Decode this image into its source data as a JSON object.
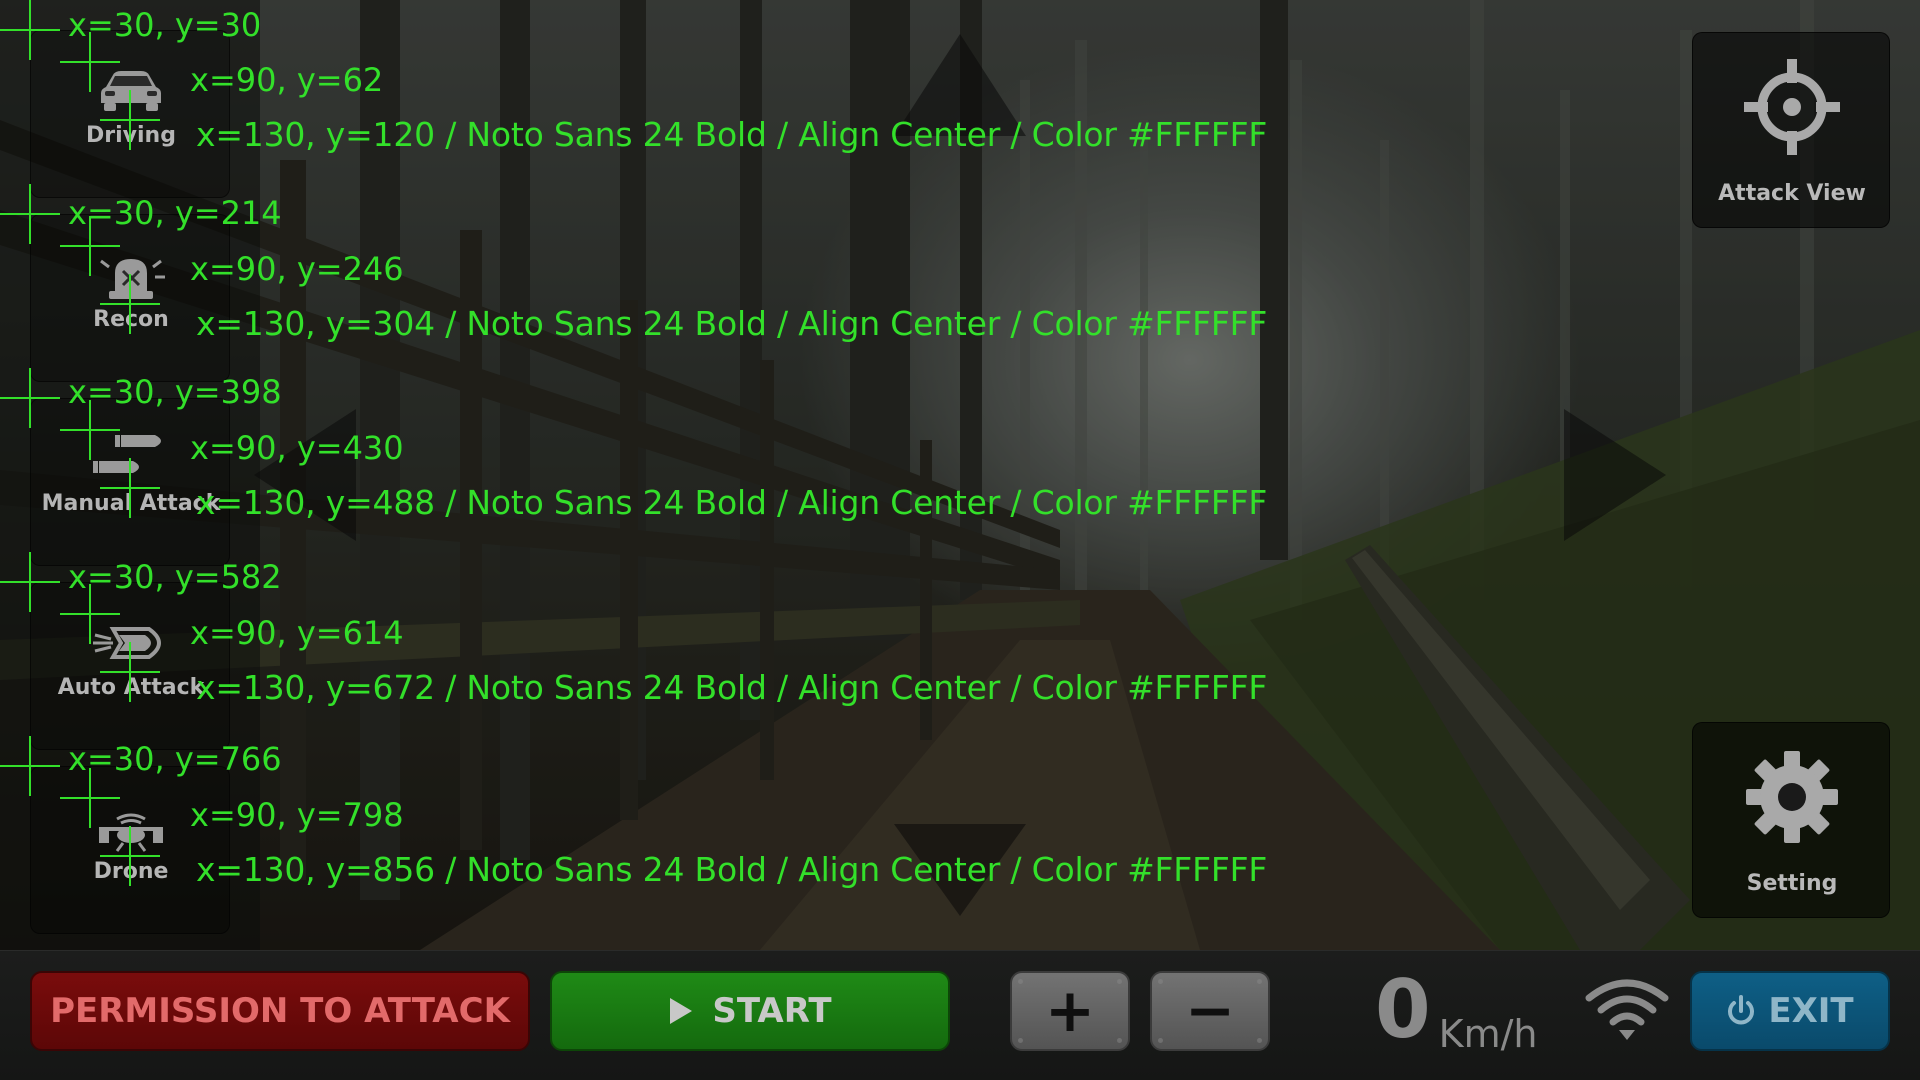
{
  "modes": [
    {
      "label": "Driving",
      "icon": "car-icon",
      "guide": {
        "frame": "x=30, y=30",
        "icon": "x=90, y=62",
        "text": "x=130, y=120 / Noto Sans 24 Bold / Align Center / Color #FFFFFF"
      }
    },
    {
      "label": "Recon",
      "icon": "siren-icon",
      "guide": {
        "frame": "x=30, y=214",
        "icon": "x=90, y=246",
        "text": "x=130, y=304 / Noto Sans 24 Bold / Align Center / Color #FFFFFF"
      }
    },
    {
      "label": "Manual Attack",
      "icon": "bullets-icon",
      "guide": {
        "frame": "x=30, y=398",
        "icon": "x=90, y=430",
        "text": "x=130, y=488 / Noto Sans 24 Bold / Align Center / Color #FFFFFF"
      }
    },
    {
      "label": "Auto Attack",
      "icon": "rocket-icon",
      "guide": {
        "frame": "x=30, y=582",
        "icon": "x=90, y=614",
        "text": "x=130, y=672 / Noto Sans 24 Bold / Align Center / Color #FFFFFF"
      }
    },
    {
      "label": "Drone",
      "icon": "drone-icon",
      "guide": {
        "frame": "x=30, y=766",
        "icon": "x=90, y=798",
        "text": "x=130, y=856 / Noto Sans 24 Bold / Align Center / Color #FFFFFF"
      }
    }
  ],
  "right_panel": {
    "attack_view": {
      "label": "Attack View",
      "icon": "crosshair-icon"
    },
    "setting": {
      "label": "Setting",
      "icon": "gear-icon"
    }
  },
  "bottom_bar": {
    "permission_label": "PERMISSION TO ATTACK",
    "start_label": "START",
    "plus_label": "+",
    "minus_label": "−",
    "speed_value": "0",
    "speed_unit": "Km/h",
    "exit_label": "EXIT"
  },
  "colors": {
    "guide_text": "#33E02A",
    "permission": "#6B0A0A",
    "start": "#1A7A12",
    "exit": "#0C5478"
  }
}
